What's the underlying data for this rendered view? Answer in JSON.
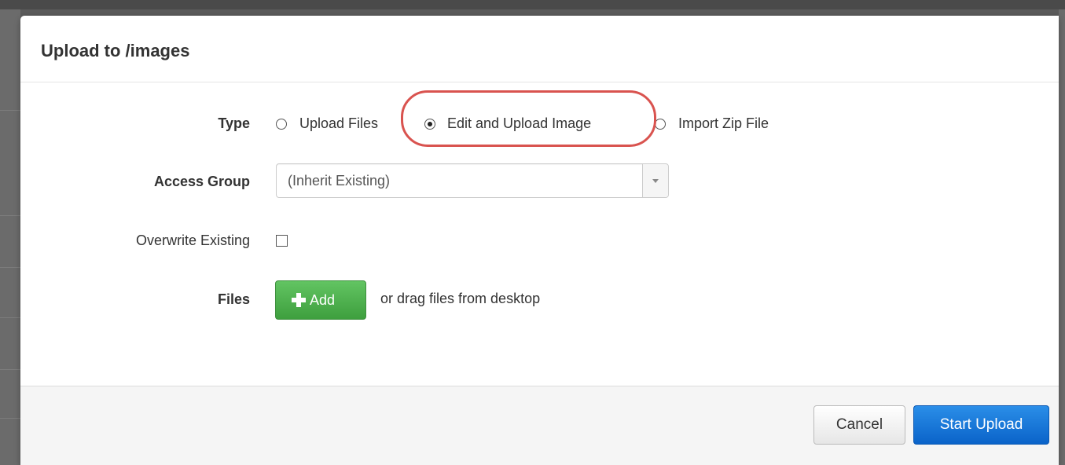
{
  "modal": {
    "title": "Upload to /images"
  },
  "form": {
    "type": {
      "label": "Type",
      "options": [
        {
          "label": "Upload Files",
          "selected": false
        },
        {
          "label": "Edit and Upload Image",
          "selected": true
        },
        {
          "label": "Import Zip File",
          "selected": false
        }
      ]
    },
    "access_group": {
      "label": "Access Group",
      "selected": "(Inherit Existing)"
    },
    "overwrite": {
      "label": "Overwrite Existing",
      "checked": false
    },
    "files": {
      "label": "Files",
      "add_label": "Add",
      "hint": "or drag files from desktop"
    }
  },
  "footer": {
    "cancel_label": "Cancel",
    "submit_label": "Start Upload"
  },
  "colors": {
    "primary": "#0a63c9",
    "success": "#3e9f3e",
    "highlight": "#d9534f"
  },
  "icons": [
    "plus-icon",
    "chevron-down-icon"
  ]
}
